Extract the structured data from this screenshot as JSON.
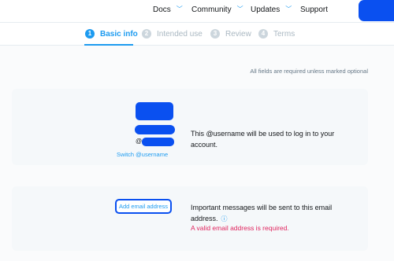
{
  "nav": {
    "items": [
      {
        "label": "Docs",
        "chevron": "chevron-down-icon"
      },
      {
        "label": "Community",
        "chevron": "chevron-down-icon"
      },
      {
        "label": "Updates",
        "chevron": "chevron-down-icon"
      },
      {
        "label": "Support"
      }
    ],
    "chevron_glyph": "﹀"
  },
  "steps": [
    {
      "number": "1",
      "label": "Basic info",
      "active": true
    },
    {
      "number": "2",
      "label": "Intended use",
      "active": false
    },
    {
      "number": "3",
      "label": "Review",
      "active": false
    },
    {
      "number": "4",
      "label": "Terms",
      "active": false
    }
  ],
  "form": {
    "required_note": "All fields are required unless marked optional",
    "username_card": {
      "at_symbol": "@",
      "switch_link": "Switch @username",
      "description": "This @username will be used to log in to your account."
    },
    "email_card": {
      "button_label": "Add email address",
      "description": "Important messages will be sent to this email address.",
      "info_icon": "ⓘ",
      "error": "A valid email address is required."
    }
  },
  "colors": {
    "accent": "#1d9bf0",
    "redacted": "#0a50f0",
    "error": "#e0245e"
  }
}
